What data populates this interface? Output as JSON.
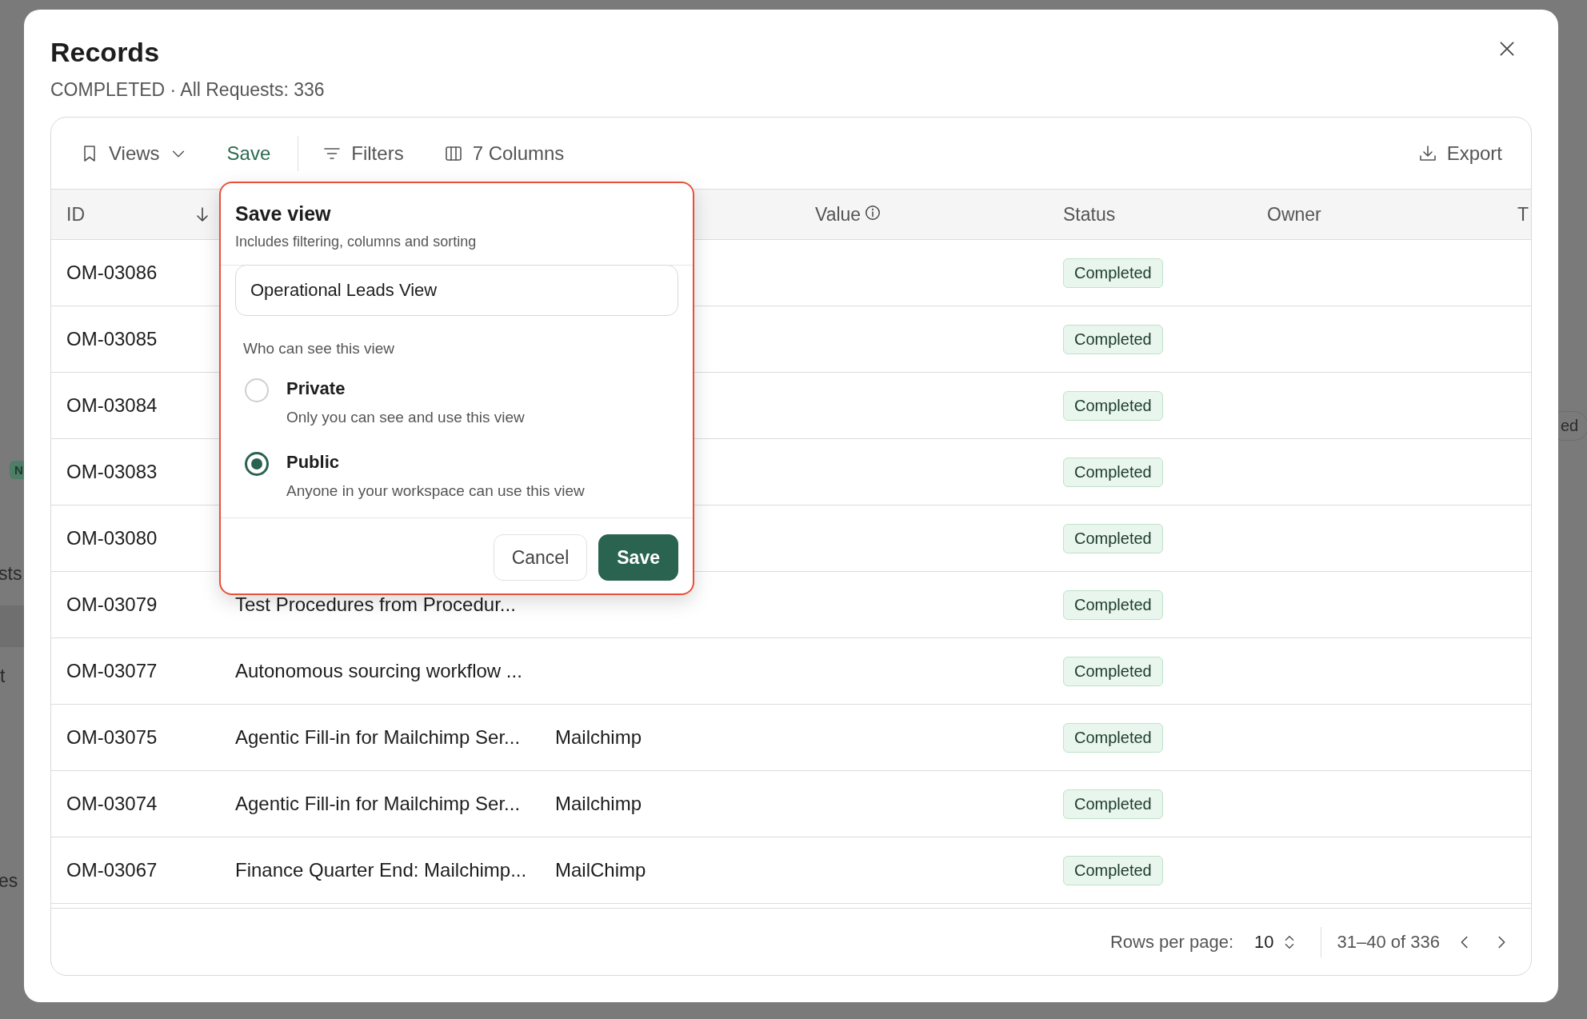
{
  "backdrop": {
    "fragments": [
      {
        "kind": "badge",
        "text": "N"
      },
      {
        "kind": "text",
        "text": "sts"
      },
      {
        "kind": "band"
      },
      {
        "kind": "text",
        "text": "t"
      },
      {
        "kind": "text",
        "text": "es"
      },
      {
        "kind": "pill",
        "text": "ed"
      }
    ]
  },
  "dialog": {
    "title": "Records",
    "subtitle": "COMPLETED · All Requests: 336"
  },
  "toolbar": {
    "items": [
      {
        "kind": "views",
        "label": "Views"
      },
      {
        "kind": "save",
        "label": "Save"
      },
      {
        "kind": "filters",
        "label": "Filters"
      },
      {
        "kind": "columns",
        "label": "7 Columns"
      }
    ],
    "export": {
      "label": "Export"
    }
  },
  "table": {
    "columns": [
      {
        "kind": "id",
        "label": "ID",
        "sorted_descending": true
      },
      {
        "kind": "value",
        "label": "Value",
        "info": true
      },
      {
        "kind": "status",
        "label": "Status"
      },
      {
        "kind": "owner",
        "label": "Owner"
      },
      {
        "kind": "cut",
        "label": "T"
      }
    ],
    "rows": [
      {
        "id": "OM-03086",
        "status": "Completed"
      },
      {
        "id": "OM-03085",
        "status": "Completed"
      },
      {
        "id": "OM-03084",
        "status": "Completed"
      },
      {
        "id": "OM-03083",
        "status": "Completed"
      },
      {
        "id": "OM-03080",
        "status": "Completed"
      },
      {
        "id": "OM-03079",
        "name": "Test Procedures from Procedur...",
        "status": "Completed"
      },
      {
        "id": "OM-03077",
        "name": "Autonomous sourcing workflow ...",
        "status": "Completed"
      },
      {
        "id": "OM-03075",
        "name": "Agentic Fill-in for Mailchimp Ser...",
        "source": "Mailchimp",
        "status": "Completed"
      },
      {
        "id": "OM-03074",
        "name": "Agentic Fill-in for Mailchimp Ser...",
        "source": "Mailchimp",
        "status": "Completed"
      },
      {
        "id": "OM-03067",
        "name": "Finance Quarter End: Mailchimp...",
        "source": "MailChimp",
        "status": "Completed"
      }
    ]
  },
  "pagination": {
    "rows_per_page_label": "Rows per page:",
    "rows_per_page": "10",
    "range": "31–40 of 336"
  },
  "save_view_popover": {
    "title": "Save view",
    "subtitle": "Includes filtering, columns and sorting",
    "name_field": {
      "value": "Operational Leads View"
    },
    "visibility_label": "Who can see this view",
    "options": [
      {
        "label": "Private",
        "description": "Only you can see and use this view",
        "selected": false
      },
      {
        "label": "Public",
        "description": "Anyone in your workspace can use this view",
        "selected": true
      }
    ],
    "buttons": [
      {
        "kind": "secondary",
        "label": "Cancel"
      },
      {
        "kind": "primary",
        "label": "Save"
      }
    ]
  }
}
